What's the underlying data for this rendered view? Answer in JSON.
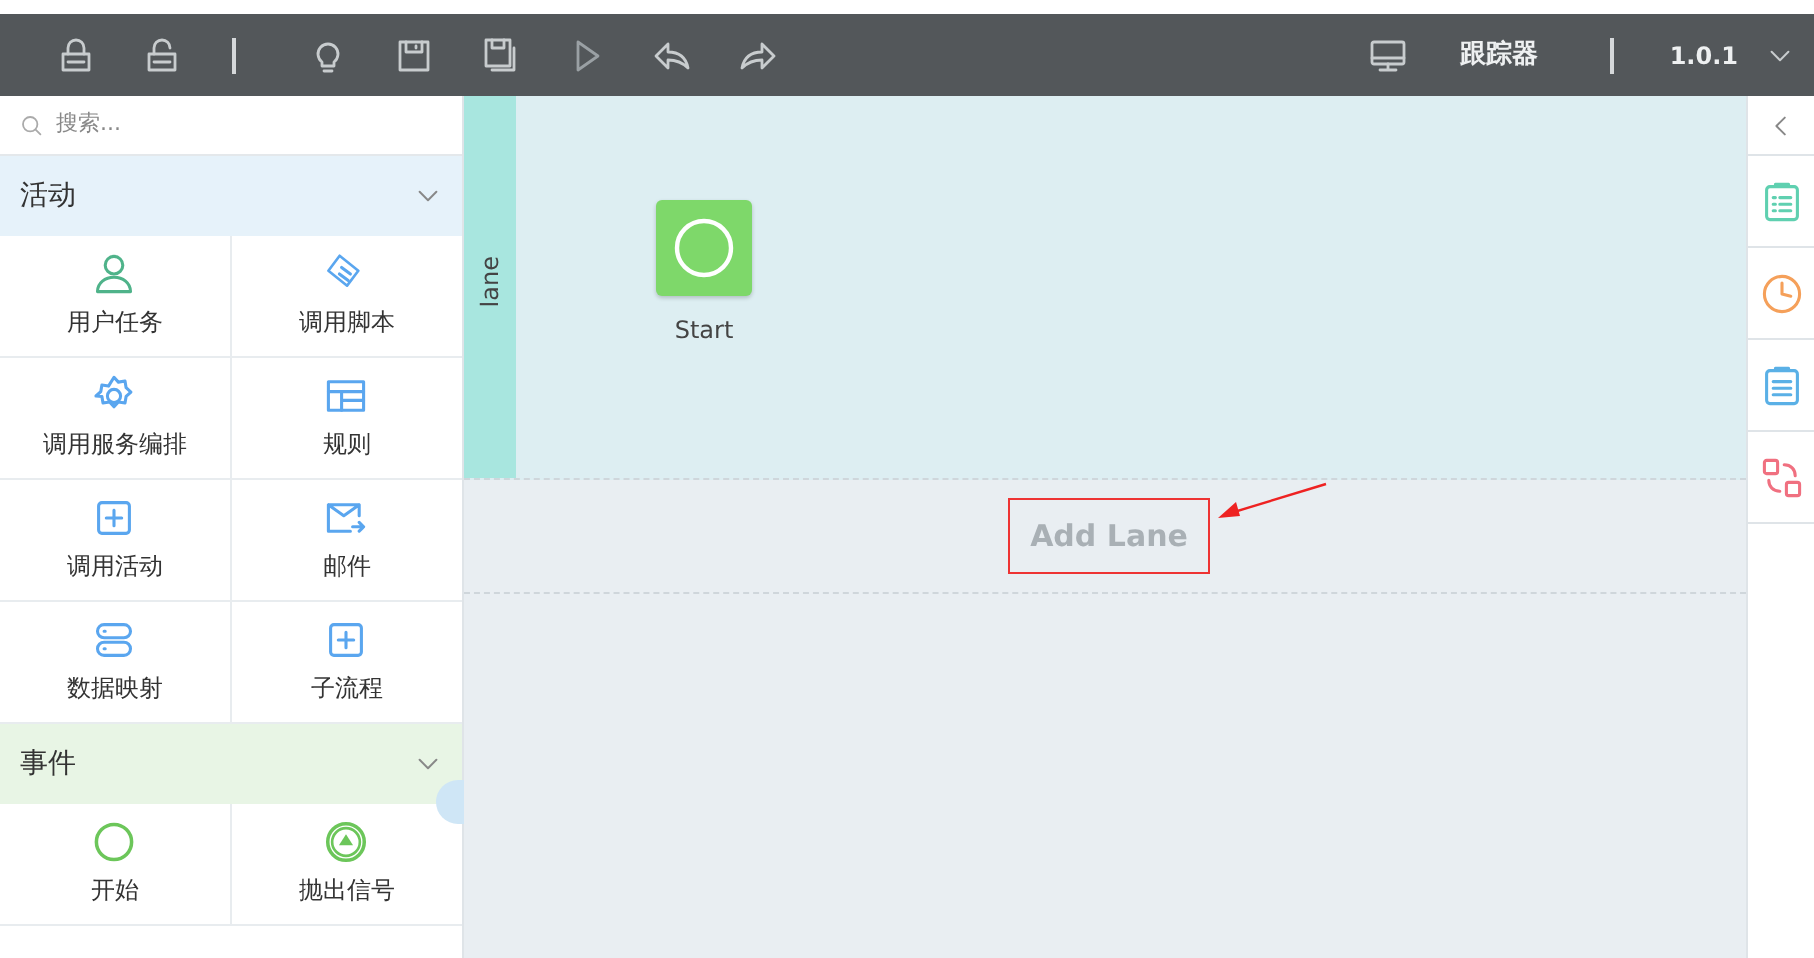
{
  "toolbar": {
    "tracker": "跟踪器",
    "version": "1.0.1"
  },
  "palette": {
    "search": {
      "placeholder": "搜索..."
    },
    "groups": [
      {
        "title": "活动",
        "expanded": true,
        "color": "#e6f2fa",
        "items": [
          {
            "label": "用户任务"
          },
          {
            "label": "调用脚本"
          },
          {
            "label": "调用服务编排"
          },
          {
            "label": "规则"
          },
          {
            "label": "调用活动"
          },
          {
            "label": "邮件"
          },
          {
            "label": "数据映射"
          },
          {
            "label": "子流程"
          }
        ]
      },
      {
        "title": "事件",
        "expanded": true,
        "color": "#e8f5e5",
        "items": [
          {
            "label": "开始"
          },
          {
            "label": "抛出信号"
          }
        ]
      }
    ]
  },
  "canvas": {
    "lane": {
      "label": "lane"
    },
    "nodes": [
      {
        "label": "Start"
      }
    ],
    "add_lane": "Add Lane"
  }
}
